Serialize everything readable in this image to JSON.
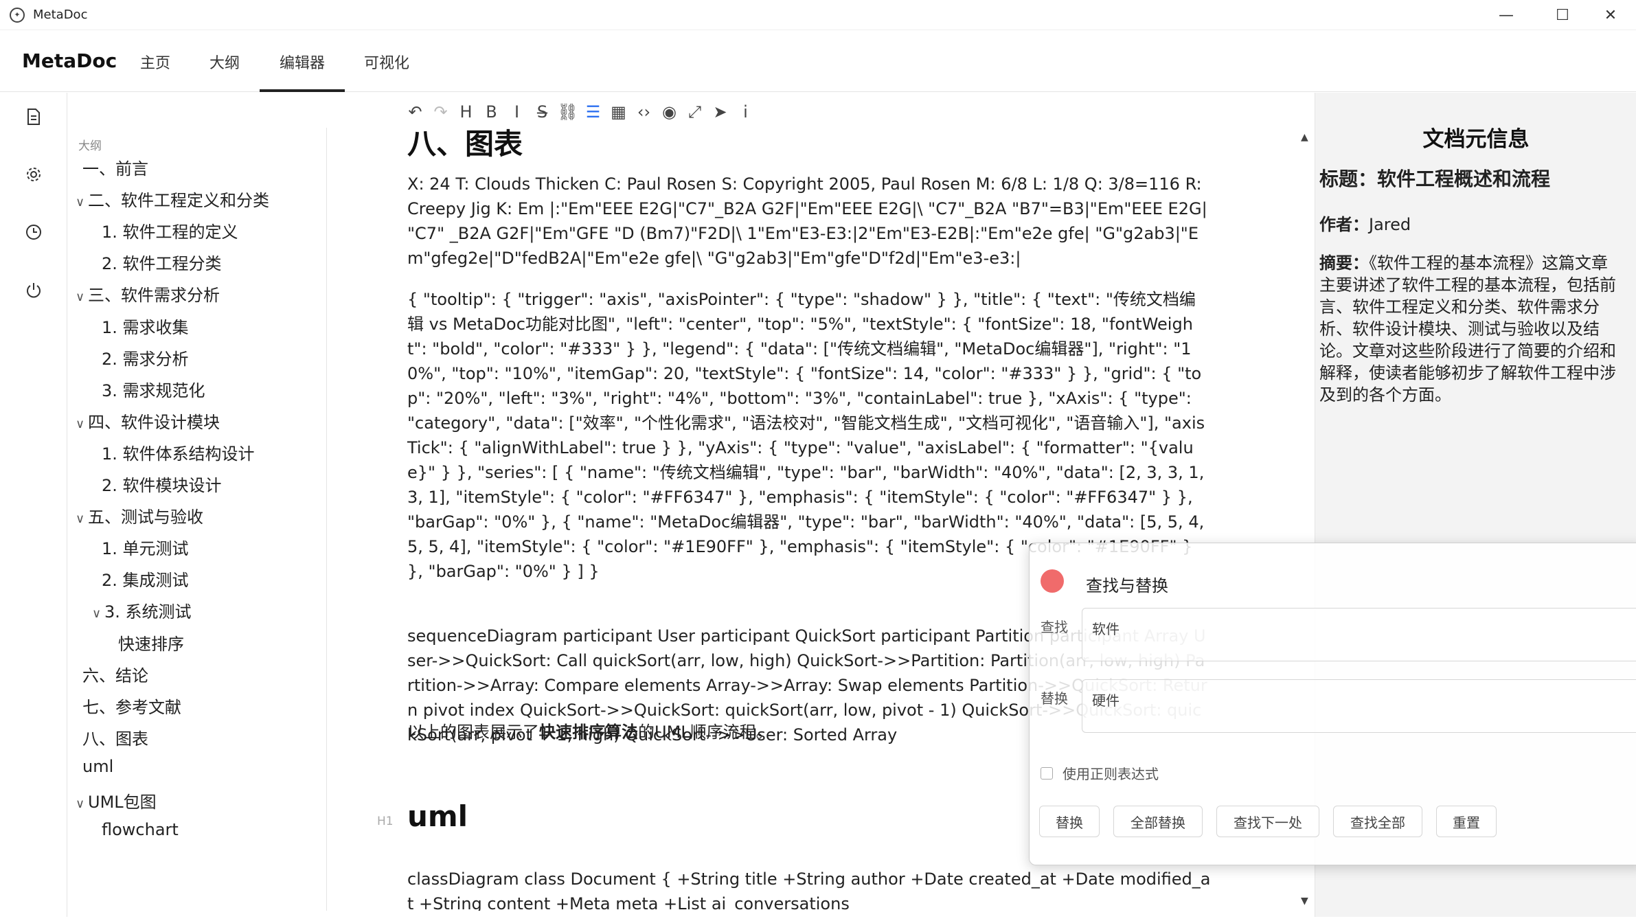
{
  "window": {
    "title": "MetaDoc"
  },
  "header": {
    "brand": "MetaDoc",
    "nav": [
      "主页",
      "大纲",
      "编辑器",
      "可视化"
    ],
    "active_nav": "编辑器"
  },
  "rail": {
    "icons": [
      "document-icon",
      "gear-icon",
      "clock-icon",
      "power-icon"
    ]
  },
  "outline": {
    "title": "大纲",
    "items": [
      {
        "label": "一、前言",
        "level": 0,
        "caret": ""
      },
      {
        "label": "二、软件工程定义和分类",
        "level": 0,
        "caret": "∨"
      },
      {
        "label": "1. 软件工程的定义",
        "level": 1,
        "caret": ""
      },
      {
        "label": "2. 软件工程分类",
        "level": 1,
        "caret": ""
      },
      {
        "label": "三、软件需求分析",
        "level": 0,
        "caret": "∨"
      },
      {
        "label": "1. 需求收集",
        "level": 1,
        "caret": ""
      },
      {
        "label": "2. 需求分析",
        "level": 1,
        "caret": ""
      },
      {
        "label": "3. 需求规范化",
        "level": 1,
        "caret": ""
      },
      {
        "label": "四、软件设计模块",
        "level": 0,
        "caret": "∨"
      },
      {
        "label": "1. 软件体系结构设计",
        "level": 1,
        "caret": ""
      },
      {
        "label": "2. 软件模块设计",
        "level": 1,
        "caret": ""
      },
      {
        "label": "五、测试与验收",
        "level": 0,
        "caret": "∨"
      },
      {
        "label": "1. 单元测试",
        "level": 1,
        "caret": ""
      },
      {
        "label": "2. 集成测试",
        "level": 1,
        "caret": ""
      },
      {
        "label": "3. 系统测试",
        "level": 1,
        "caret": "∨"
      },
      {
        "label": "快速排序",
        "level": 2,
        "caret": ""
      },
      {
        "label": "六、结论",
        "level": 0,
        "caret": ""
      },
      {
        "label": "七、参考文献",
        "level": 0,
        "caret": ""
      },
      {
        "label": "八、图表",
        "level": 0,
        "caret": ""
      },
      {
        "label": "uml",
        "level": 0,
        "caret": ""
      },
      {
        "label": "UML包图",
        "level": 0,
        "caret": "∨"
      },
      {
        "label": "flowchart",
        "level": 1,
        "caret": ""
      }
    ]
  },
  "toolbar": {
    "buttons": [
      {
        "name": "undo-icon",
        "glyph": "↶"
      },
      {
        "name": "redo-icon",
        "glyph": "↷"
      },
      {
        "name": "heading-icon",
        "glyph": "H"
      },
      {
        "name": "bold-icon",
        "glyph": "B"
      },
      {
        "name": "italic-icon",
        "glyph": "I"
      },
      {
        "name": "strikethrough-icon",
        "glyph": "S̶"
      },
      {
        "name": "link-icon",
        "glyph": "⛓"
      },
      {
        "name": "list-icon",
        "glyph": "☰"
      },
      {
        "name": "table-icon",
        "glyph": "▦"
      },
      {
        "name": "code-icon",
        "glyph": "‹›"
      },
      {
        "name": "eye-icon",
        "glyph": "◉"
      },
      {
        "name": "fullscreen-icon",
        "glyph": "⤢"
      },
      {
        "name": "send-icon",
        "glyph": "➤"
      },
      {
        "name": "info-icon",
        "glyph": "i"
      }
    ]
  },
  "editor": {
    "heading_partial": "八、图表",
    "abc": "X: 24 T: Clouds Thicken C: Paul Rosen S: Copyright 2005, Paul Rosen M: 6/8 L: 1/8 Q: 3/8=116 R: Creepy Jig K: Em |:\"Em\"EEE E2G|\"C7\"_B2A G2F|\"Em\"EEE E2G|\\ \"C7\"_B2A \"B7\"=B3|\"Em\"EEE E2G| \"C7\" _B2A G2F|\"Em\"GFE \"D (Bm7)\"F2D|\\ 1\"Em\"E3-E3:|2\"Em\"E3-E2B|:\"Em\"e2e gfe| \"G\"g2ab3|\"Em\"gfeg2e|\"D\"fedB2A|\"Em\"e2e gfe|\\ \"G\"g2ab3|\"Em\"gfe\"D\"f2d|\"Em\"e3-e3:|",
    "echarts": "{    \"tooltip\": {      \"trigger\": \"axis\",      \"axisPointer\": {        \"type\": \"shadow\"      }    },    \"title\": {      \"text\": \"传统文档编辑 vs MetaDoc功能对比图\",      \"left\": \"center\",      \"top\": \"5%\",      \"textStyle\": {        \"fontSize\": 18,        \"fontWeight\": \"bold\",        \"color\": \"#333\"      }    },    \"legend\": {      \"data\": [\"传统文档编辑\", \"MetaDoc编辑器\"],      \"right\": \"10%\",      \"top\": \"10%\",      \"itemGap\": 20,      \"textStyle\": {        \"fontSize\": 14,        \"color\": \"#333\"      }    },    \"grid\": {      \"top\": \"20%\",      \"left\": \"3%\",      \"right\": \"4%\",      \"bottom\": \"3%\",      \"containLabel\": true    },    \"xAxis\": {      \"type\": \"category\",      \"data\": [\"效率\", \"个性化需求\", \"语法校对\", \"智能文档生成\", \"文档可视化\", \"语音输入\"],      \"axisTick\": {        \"alignWithLabel\": true      }    },    \"yAxis\": {      \"type\": \"value\",      \"axisLabel\": {        \"formatter\": \"{value}\"      }    },    \"series\": [      {        \"name\": \"传统文档编辑\",        \"type\": \"bar\",        \"barWidth\": \"40%\",        \"data\": [2, 3, 3, 1, 3, 1],        \"itemStyle\": {          \"color\": \"#FF6347\"        },        \"emphasis\": {          \"itemStyle\": {            \"color\": \"#FF6347\"          }        },        \"barGap\": \"0%\"      },      {        \"name\": \"MetaDoc编辑器\",        \"type\": \"bar\",        \"barWidth\": \"40%\",        \"data\": [5, 5, 4, 5, 5, 4],        \"itemStyle\": {          \"color\": \"#1E90FF\"        },        \"emphasis\": {          \"itemStyle\": {            \"color\": \"#1E90FF\"          }        },        \"barGap\": \"0%\"      }    ]  }",
    "sequence": "sequenceDiagram      participant User      participant QuickSort      participant Partition      participant Array      User->>QuickSort: Call quickSort(arr, low, high)      QuickSort->>Partition: Partition(arr, low, high)      Partition->>Array: Compare elements      Array->>Array: Swap elements      Partition->>QuickSort: Return pivot index      QuickSort->>QuickSort: quickSort(arr, low, pivot - 1)      QuickSort->>QuickSort: quickSort(arr, pivot + 1, high)      QuickSort-->>User: Sorted Array",
    "caption_prefix": "以上的图表展示了",
    "caption_bold": "快速排序算法",
    "caption_suffix": "的UML顺序流程。",
    "h1_marker": "H1",
    "h1_text": "uml",
    "class_diagram": "classDiagram      class Document {          +String title          +String author          +Date created_at          +Date modified_at          +String content          +Meta meta          +List ai_conversations"
  },
  "meta": {
    "title": "文档元信息",
    "label_title": "标题：",
    "doc_title": "软件工程概述和流程",
    "label_author": "作者：",
    "author": "Jared",
    "label_abstract": "摘要：",
    "abstract": "《软件工程的基本流程》这篇文章主要讲述了软件工程的基本流程，包括前言、软件工程定义和分类、软件需求分析、软件设计模块、测试与验收以及结论。文章对这些阶段进行了简要的介绍和解释，使读者能够初步了解软件工程中涉及到的各个方面。"
  },
  "find_replace": {
    "title": "查找与替换",
    "find_label": "查找",
    "find_value": "软件",
    "replace_label": "替换",
    "replace_value": "硬件",
    "regex_label": "使用正则表达式",
    "buttons": [
      "替换",
      "全部替换",
      "查找下一处",
      "查找全部",
      "重置"
    ],
    "close_color": "#F06B6B"
  }
}
